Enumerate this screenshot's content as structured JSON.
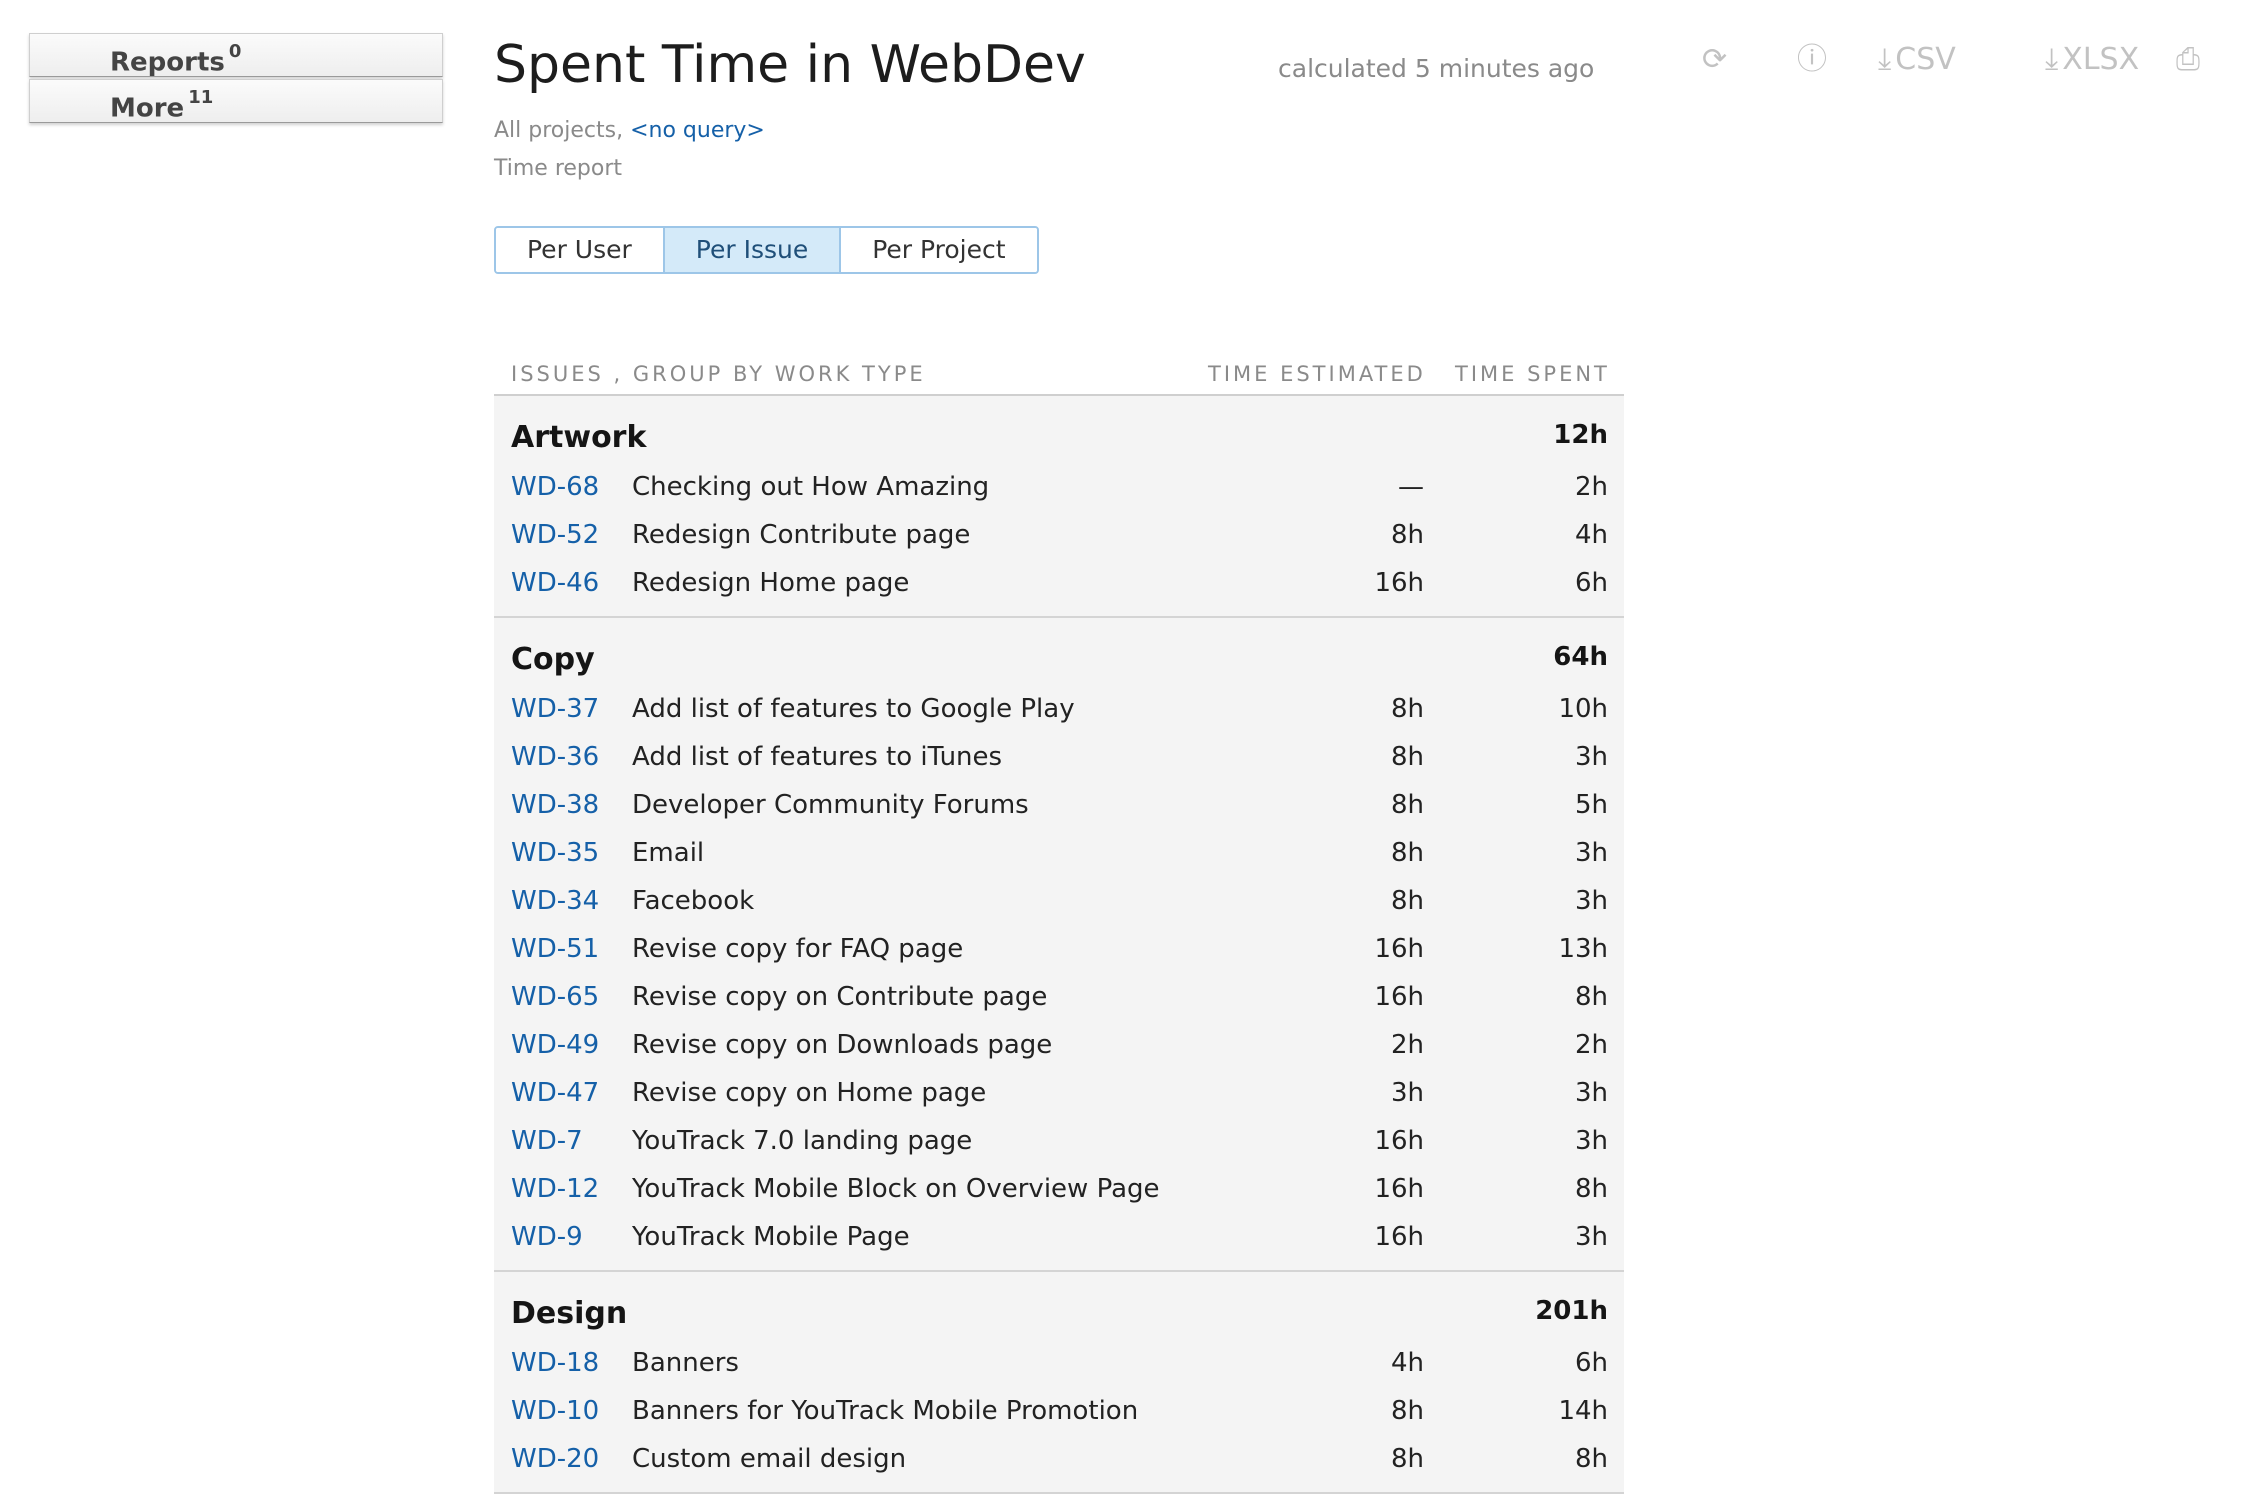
{
  "sidebar": {
    "items": [
      {
        "label": "Reports",
        "count": "0"
      },
      {
        "label": "More",
        "count": "11"
      }
    ]
  },
  "header": {
    "title": "Spent Time in WebDev",
    "calculated": "calculated 5 minutes ago",
    "actions": [
      {
        "name": "refresh-icon",
        "glyph": "⟳",
        "label": ""
      },
      {
        "name": "info-icon",
        "glyph": "ⓘ",
        "label": ""
      },
      {
        "name": "download-csv-icon",
        "glyph": "⤓",
        "label": "CSV"
      },
      {
        "name": "download-xlsx-icon",
        "glyph": "⤓",
        "label": "XLSX"
      },
      {
        "name": "print-icon",
        "glyph": "⎙",
        "label": ""
      }
    ],
    "scope_prefix": "All projects,",
    "query_link": "<no query>",
    "report_type": "Time report"
  },
  "tabs": [
    {
      "label": "Per User",
      "active": false
    },
    {
      "label": "Per Issue",
      "active": true
    },
    {
      "label": "Per Project",
      "active": false
    }
  ],
  "table": {
    "col_issues": "ISSUES , GROUP BY WORK TYPE",
    "col_estimated": "TIME ESTIMATED",
    "col_spent": "TIME SPENT",
    "groups": [
      {
        "name": "Artwork",
        "total": "12h",
        "rows": [
          {
            "id": "WD-68",
            "summary": "Checking out How Amazing",
            "estimated": "—",
            "spent": "2h"
          },
          {
            "id": "WD-52",
            "summary": "Redesign Contribute page",
            "estimated": "8h",
            "spent": "4h"
          },
          {
            "id": "WD-46",
            "summary": "Redesign Home page",
            "estimated": "16h",
            "spent": "6h"
          }
        ]
      },
      {
        "name": "Copy",
        "total": "64h",
        "rows": [
          {
            "id": "WD-37",
            "summary": "Add list of features to Google Play",
            "estimated": "8h",
            "spent": "10h"
          },
          {
            "id": "WD-36",
            "summary": "Add list of features to iTunes",
            "estimated": "8h",
            "spent": "3h"
          },
          {
            "id": "WD-38",
            "summary": "Developer Community Forums",
            "estimated": "8h",
            "spent": "5h"
          },
          {
            "id": "WD-35",
            "summary": "Email",
            "estimated": "8h",
            "spent": "3h"
          },
          {
            "id": "WD-34",
            "summary": "Facebook",
            "estimated": "8h",
            "spent": "3h"
          },
          {
            "id": "WD-51",
            "summary": "Revise copy for FAQ page",
            "estimated": "16h",
            "spent": "13h"
          },
          {
            "id": "WD-65",
            "summary": "Revise copy on Contribute page",
            "estimated": "16h",
            "spent": "8h"
          },
          {
            "id": "WD-49",
            "summary": "Revise copy on Downloads page",
            "estimated": "2h",
            "spent": "2h"
          },
          {
            "id": "WD-47",
            "summary": "Revise copy on Home page",
            "estimated": "3h",
            "spent": "3h"
          },
          {
            "id": "WD-7",
            "summary": "YouTrack 7.0 landing page",
            "estimated": "16h",
            "spent": "3h"
          },
          {
            "id": "WD-12",
            "summary": "YouTrack Mobile Block on Overview Page",
            "estimated": "16h",
            "spent": "8h"
          },
          {
            "id": "WD-9",
            "summary": "YouTrack Mobile Page",
            "estimated": "16h",
            "spent": "3h"
          }
        ]
      },
      {
        "name": "Design",
        "total": "201h",
        "rows": [
          {
            "id": "WD-18",
            "summary": "Banners",
            "estimated": "4h",
            "spent": "6h"
          },
          {
            "id": "WD-10",
            "summary": "Banners for YouTrack Mobile Promotion",
            "estimated": "8h",
            "spent": "14h"
          },
          {
            "id": "WD-20",
            "summary": "Custom email design",
            "estimated": "8h",
            "spent": "8h"
          }
        ]
      }
    ]
  }
}
